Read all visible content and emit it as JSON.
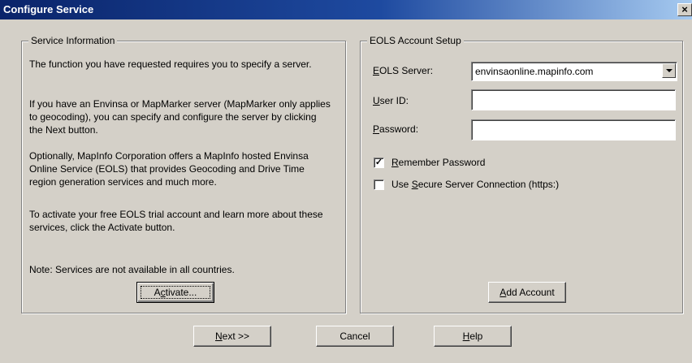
{
  "window": {
    "title": "Configure Service",
    "close_glyph": "×"
  },
  "service_info": {
    "legend": "Service Information",
    "paragraphs": [
      "The function you have requested requires you to specify a server.",
      "If you have an Envinsa or MapMarker server (MapMarker only applies to geocoding), you can specify and configure the server by clicking the Next button.",
      "Optionally, MapInfo Corporation offers a MapInfo hosted Envinsa Online Service (EOLS) that provides Geocoding and Drive Time region generation services and much more.",
      "To activate your free EOLS trial account and learn more about these services, click the Activate button."
    ],
    "note": "Note: Services are not available in all countries.",
    "activate_button": {
      "pre": "A",
      "mnemonic": "c",
      "post": "tivate..."
    }
  },
  "eols": {
    "legend": "EOLS Account Setup",
    "server_label": {
      "mnemonic": "E",
      "rest": "OLS Server:"
    },
    "server_value": "envinsaonline.mapinfo.com",
    "user_id_label": {
      "mnemonic": "U",
      "rest": "ser ID:"
    },
    "user_id_value": "",
    "password_label": {
      "mnemonic": "P",
      "rest": "assword:"
    },
    "password_value": "",
    "remember_password": {
      "mnemonic": "R",
      "rest": "emember Password",
      "checked": true
    },
    "secure_connection": {
      "pre": "Use ",
      "mnemonic": "S",
      "rest": "ecure Server Connection (https:)",
      "checked": false
    },
    "add_account_button": {
      "mnemonic": "A",
      "rest": "dd Account"
    }
  },
  "footer": {
    "next_button": {
      "mnemonic": "N",
      "rest": "ext >>"
    },
    "cancel_button": "Cancel",
    "help_button": {
      "mnemonic": "H",
      "rest": "elp"
    }
  }
}
